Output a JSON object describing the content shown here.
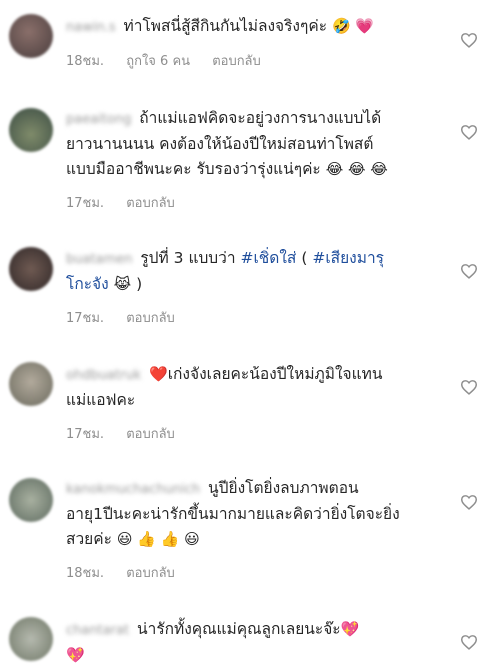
{
  "comments": [
    {
      "username": "nawin.s",
      "text": "ท่าโพสนี่สู้สีกินกันไม่ลงจริงๆค่ะ",
      "emoji": "🤣 💗",
      "time": "18ชม.",
      "likes": "ถูกใจ 6 คน",
      "reply": "ตอบกลับ"
    },
    {
      "username": "paeaitong",
      "line1": "ถ้าแม่แอฟคิดจะอยู่วงการนางแบบได้",
      "line2": "ยาวนานนนน คงต้องให้น้องปีใหม่สอนท่าโพสต์",
      "line3": "แบบมืออาชีพนะคะ รับรองว่ารุ่งแน่ๆค่ะ",
      "emoji": "😂 😂 😂",
      "time": "17ชม.",
      "reply": "ตอบกลับ"
    },
    {
      "username": "buatamen",
      "line1_pre": "รูปที่ 3 แบบว่า",
      "tag1": "#เชิ่ดใส่",
      "line1_mid": "(",
      "tag2": "#เสียงมารุ",
      "line2_tag": "โกะจัง",
      "emoji": "😹",
      "line2_post": ")",
      "time": "17ชม.",
      "reply": "ตอบกลับ"
    },
    {
      "username": "ohdbuatruk",
      "emoji": "❤️",
      "line1": "เก่งจังเลยคะน้องปีใหม่ภูมิใจแทน",
      "line2": "แม่แอฟคะ",
      "time": "17ชม.",
      "reply": "ตอบกลับ"
    },
    {
      "username": "kanokmuchachunich",
      "line1": "นูปียิ่งโตยิ่งลบภาพตอน",
      "line2": "อายุ1ปีนะคะน่ารักขึ้นมากมายและคิดว่ายิ่งโตจะยิ่ง",
      "line3": "สวยค่ะ",
      "emoji": "😃 👍 👍 😃",
      "time": "18ชม.",
      "reply": "ตอบกลับ"
    },
    {
      "username": "chantarat",
      "line1": "น่ารักทั้งคุณแม่คุณลูกเลยนะจ๊ะ",
      "emoji1": "💖",
      "emoji2": "💖"
    }
  ],
  "colors": {
    "text": "#262626",
    "meta": "#8e8e8e",
    "hashtag": "#1f4e9c"
  }
}
